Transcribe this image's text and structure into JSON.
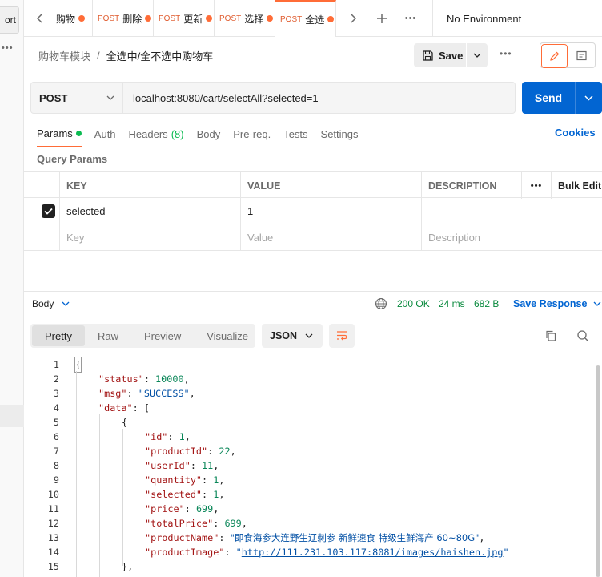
{
  "sidebar": {
    "import_label": "ort"
  },
  "tabs": [
    {
      "method": "",
      "title": "购物",
      "dirty": true
    },
    {
      "method": "POST",
      "title": "删除",
      "dirty": true
    },
    {
      "method": "POST",
      "title": "更新",
      "dirty": true
    },
    {
      "method": "POST",
      "title": "选择",
      "dirty": true
    },
    {
      "method": "POST",
      "title": "全选",
      "dirty": true,
      "active": true
    }
  ],
  "environment": "No Environment",
  "breadcrumb": {
    "parent": "购物车模块",
    "separator": "/",
    "current": "全选中/全不选中购物车"
  },
  "save_label": "Save",
  "request": {
    "method": "POST",
    "url": "localhost:8080/cart/selectAll?selected=1"
  },
  "send_label": "Send",
  "request_tabs": {
    "params": "Params",
    "auth": "Auth",
    "headers": "Headers",
    "headers_count": "(8)",
    "body": "Body",
    "prereq": "Pre-req.",
    "tests": "Tests",
    "settings": "Settings"
  },
  "cookies_label": "Cookies",
  "query_params_title": "Query Params",
  "params_table": {
    "headers": {
      "key": "KEY",
      "value": "VALUE",
      "description": "DESCRIPTION",
      "bulk_edit": "Bulk Edit"
    },
    "rows": [
      {
        "key": "selected",
        "value": "1",
        "description": "",
        "checked": true
      }
    ],
    "placeholders": {
      "key": "Key",
      "value": "Value",
      "description": "Description"
    }
  },
  "response": {
    "section_label": "Body",
    "status": "200 OK",
    "time": "24 ms",
    "size": "682 B",
    "save_label": "Save Response",
    "view_tabs": [
      "Pretty",
      "Raw",
      "Preview",
      "Visualize"
    ],
    "format": "JSON"
  },
  "code_lines": [
    {
      "num": "1",
      "text": "{"
    },
    {
      "num": "2",
      "key": "\"status\"",
      "val": "10000",
      "type": "n",
      "tail": ","
    },
    {
      "num": "3",
      "key": "\"msg\"",
      "val": "\"SUCCESS\"",
      "type": "s",
      "tail": ","
    },
    {
      "num": "4",
      "key": "\"data\"",
      "val": "[",
      "type": "p",
      "tail": ""
    },
    {
      "num": "5",
      "text": "{"
    },
    {
      "num": "6",
      "key": "\"id\"",
      "val": "1",
      "type": "n",
      "tail": ","
    },
    {
      "num": "7",
      "key": "\"productId\"",
      "val": "22",
      "type": "n",
      "tail": ","
    },
    {
      "num": "8",
      "key": "\"userId\"",
      "val": "11",
      "type": "n",
      "tail": ","
    },
    {
      "num": "9",
      "key": "\"quantity\"",
      "val": "1",
      "type": "n",
      "tail": ","
    },
    {
      "num": "10",
      "key": "\"selected\"",
      "val": "1",
      "type": "n",
      "tail": ","
    },
    {
      "num": "11",
      "key": "\"price\"",
      "val": "699",
      "type": "n",
      "tail": ","
    },
    {
      "num": "12",
      "key": "\"totalPrice\"",
      "val": "699",
      "type": "n",
      "tail": ","
    },
    {
      "num": "13",
      "key": "\"productName\"",
      "val": "\"即食海参大连野生辽刺参 新鲜速食 特级生鲜海产 60~80G\"",
      "type": "s",
      "tail": ","
    },
    {
      "num": "14",
      "key": "\"productImage\"",
      "val": "http://111.231.103.117:8081/images/haishen.jpg",
      "type": "u",
      "tail": ""
    },
    {
      "num": "15",
      "text": "},"
    }
  ],
  "colors": {
    "accent": "#ff6c37",
    "send": "#0265d2",
    "ok": "#0a8a3e",
    "link": "#0265d2"
  }
}
